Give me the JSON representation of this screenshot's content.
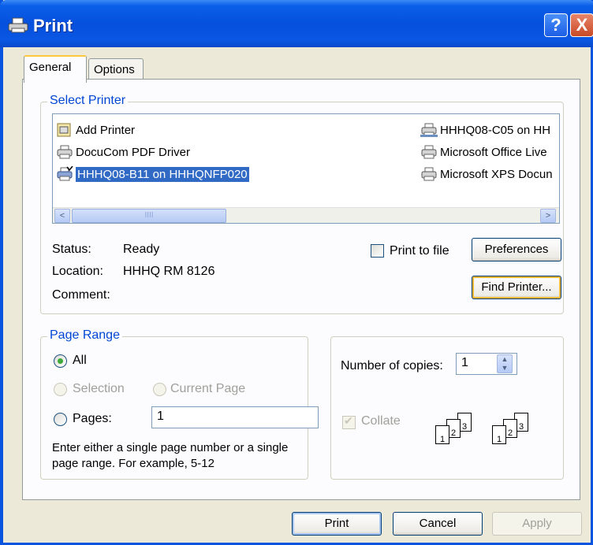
{
  "window": {
    "title": "Print",
    "help_label": "?",
    "close_label": "X"
  },
  "tabs": [
    {
      "label": "General",
      "active": true
    },
    {
      "label": "Options",
      "active": false
    }
  ],
  "select_printer": {
    "title": "Select Printer",
    "printers": [
      {
        "label": "Add Printer",
        "icon": "add-printer-icon",
        "selected": false
      },
      {
        "label": "DocuCom PDF Driver",
        "icon": "printer-icon",
        "selected": false
      },
      {
        "label": "HHHQ08-B11 on HHHQNFP020",
        "icon": "network-printer-icon",
        "selected": true
      },
      {
        "label": "HHHQ08-C05 on HH",
        "icon": "network-printer-icon",
        "selected": false
      },
      {
        "label": "Microsoft Office Live",
        "icon": "printer-icon",
        "selected": false
      },
      {
        "label": "Microsoft XPS Docun",
        "icon": "printer-icon",
        "selected": false
      }
    ],
    "scroll_left": "<",
    "scroll_right": ">",
    "scroll_grip": "IIII",
    "status_label": "Status:",
    "status_value": "Ready",
    "location_label": "Location:",
    "location_value": "HHHQ RM 8126",
    "comment_label": "Comment:",
    "comment_value": "",
    "print_to_file_label": "Print to file",
    "print_to_file_checked": false,
    "preferences_label": "Preferences",
    "find_printer_label": "Find Printer..."
  },
  "page_range": {
    "title": "Page Range",
    "all_label": "All",
    "selection_label": "Selection",
    "current_page_label": "Current Page",
    "pages_label": "Pages:",
    "pages_value": "1",
    "selected_option": "All",
    "hint_line1": "Enter either a single page number or a single",
    "hint_line2": "page range.  For example, 5-12"
  },
  "copies": {
    "number_label": "Number of copies:",
    "number_value": "1",
    "collate_label": "Collate",
    "collate_checked": true,
    "collate_enabled": false,
    "page_numbers": [
      "1",
      "2",
      "3"
    ]
  },
  "buttons": {
    "print": "Print",
    "cancel": "Cancel",
    "apply": "Apply"
  }
}
